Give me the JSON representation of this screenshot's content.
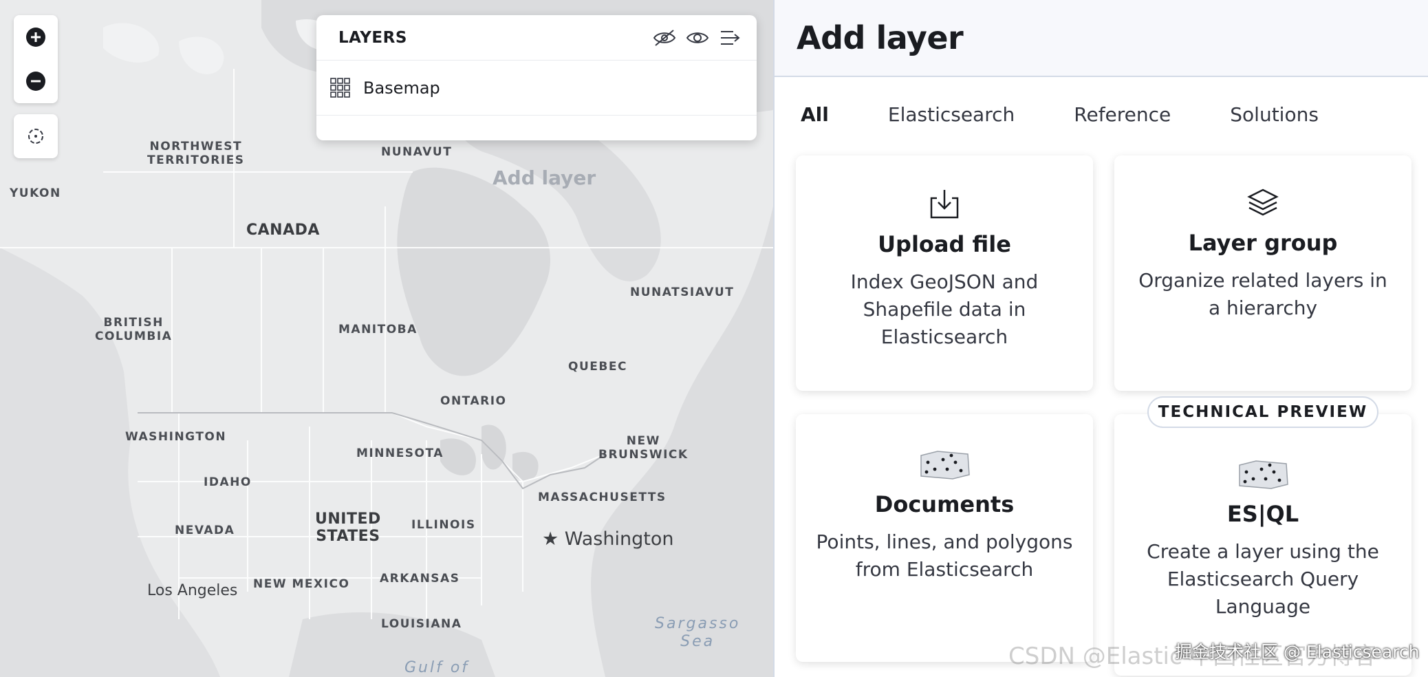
{
  "map": {
    "zoom_in_label": "+",
    "zoom_out_label": "−",
    "labels": {
      "northwest_territories": "NORTHWEST\nTERRITORIES",
      "yukon": "YUKON",
      "nunavut": "NUNAVUT",
      "canada": "CANADA",
      "nunatsiavut": "NUNATSIAVUT",
      "british_columbia": "BRITISH\nCOLUMBIA",
      "manitoba": "MANITOBA",
      "quebec": "QUEBEC",
      "ontario": "ONTARIO",
      "washington_state": "WASHINGTON",
      "minnesota": "MINNESOTA",
      "new_brunswick": "NEW\nBRUNSWICK",
      "idaho": "IDAHO",
      "massachusetts": "MASSACHUSETTS",
      "united_states": "UNITED\nSTATES",
      "illinois": "ILLINOIS",
      "nevada": "NEVADA",
      "washington_city": "Washington",
      "new_mexico": "NEW MEXICO",
      "arkansas": "ARKANSAS",
      "los_angeles": "Los Angeles",
      "louisiana": "LOUISIANA",
      "sargasso_sea": "Sargasso\nSea",
      "gulf_of": "Gulf of"
    },
    "ghost_text": "Add layer"
  },
  "layers_panel": {
    "title": "LAYERS",
    "items": [
      {
        "name": "Basemap"
      }
    ]
  },
  "add_layer": {
    "title": "Add layer",
    "tabs": [
      {
        "label": "All",
        "active": true
      },
      {
        "label": "Elasticsearch",
        "active": false
      },
      {
        "label": "Reference",
        "active": false
      },
      {
        "label": "Solutions",
        "active": false
      }
    ],
    "cards": [
      {
        "title": "Upload file",
        "description": "Index GeoJSON and Shapefile data in Elasticsearch",
        "icon": "upload-icon"
      },
      {
        "title": "Layer group",
        "description": "Organize related layers in a hierarchy",
        "icon": "layers-icon"
      },
      {
        "title": "Documents",
        "description": "Points, lines, and polygons from Elasticsearch",
        "icon": "documents-icon"
      },
      {
        "title": "ES|QL",
        "description": "Create a layer using the Elasticsearch Query Language",
        "icon": "esql-icon",
        "badge": "TECHNICAL PREVIEW"
      }
    ]
  },
  "watermark": {
    "text": "CSDN @Elastic 中国社区官方博客",
    "overlay": "掘金技术社区 @ Elasticsearch"
  }
}
